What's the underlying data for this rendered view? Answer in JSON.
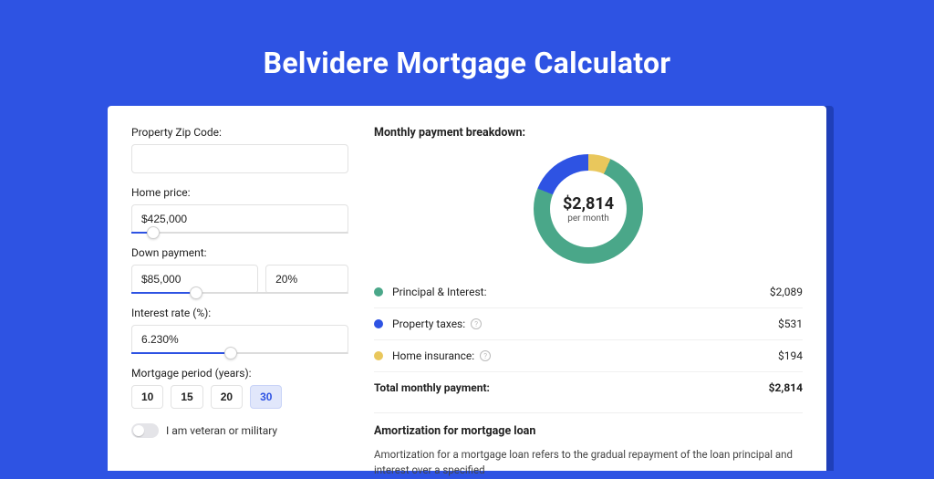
{
  "title": "Belvidere Mortgage Calculator",
  "form": {
    "zip_label": "Property Zip Code:",
    "zip_value": "",
    "home_price_label": "Home price:",
    "home_price_value": "$425,000",
    "home_price_pct": 10,
    "down_payment_label": "Down payment:",
    "down_payment_value": "$85,000",
    "down_payment_pct_value": "20%",
    "down_payment_slider_pct": 30,
    "interest_label": "Interest rate (%):",
    "interest_value": "6.230%",
    "interest_slider_pct": 46,
    "period_label": "Mortgage period (years):",
    "period_options": [
      "10",
      "15",
      "20",
      "30"
    ],
    "period_active_index": 3,
    "veteran_label": "I am veteran or military"
  },
  "breakdown": {
    "title": "Monthly payment breakdown:",
    "center_amount": "$2,814",
    "center_sub": "per month",
    "rows": [
      {
        "label": "Principal & Interest:",
        "value": "$2,089",
        "color": "green",
        "info": false
      },
      {
        "label": "Property taxes:",
        "value": "$531",
        "color": "blue",
        "info": true
      },
      {
        "label": "Home insurance:",
        "value": "$194",
        "color": "yellow",
        "info": true
      }
    ],
    "total_label": "Total monthly payment:",
    "total_value": "$2,814"
  },
  "amortization": {
    "title": "Amortization for mortgage loan",
    "text": "Amortization for a mortgage loan refers to the gradual repayment of the loan principal and interest over a specified"
  },
  "chart_data": {
    "type": "pie",
    "title": "Monthly payment breakdown",
    "series": [
      {
        "name": "Principal & Interest",
        "value": 2089,
        "color": "#4aa789"
      },
      {
        "name": "Property taxes",
        "value": 531,
        "color": "#2e53e3"
      },
      {
        "name": "Home insurance",
        "value": 194,
        "color": "#e9c75c"
      }
    ],
    "total": 2814,
    "total_label": "$2,814 per month"
  }
}
